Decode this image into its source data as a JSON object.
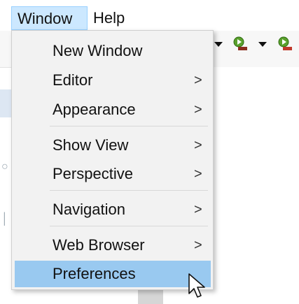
{
  "menubar": {
    "items": [
      {
        "label": "Window",
        "active": true
      },
      {
        "label": "Help",
        "active": false
      }
    ]
  },
  "menu": {
    "items": [
      {
        "label": "New Window",
        "submenu": false
      },
      {
        "label": "Editor",
        "submenu": true,
        "chevron": ">"
      },
      {
        "label": "Appearance",
        "submenu": true,
        "chevron": ">"
      },
      {
        "label": "Show View",
        "submenu": true,
        "chevron": ">"
      },
      {
        "label": "Perspective",
        "submenu": true,
        "chevron": ">"
      },
      {
        "label": "Navigation",
        "submenu": true,
        "chevron": ">"
      },
      {
        "label": "Web Browser",
        "submenu": true,
        "chevron": ">"
      },
      {
        "label": "Preferences",
        "submenu": false,
        "selected": true
      }
    ]
  },
  "colors": {
    "menu_bg": "#f2f2f2",
    "selected_bg": "#99c9f0",
    "menubar_active": "#cce8ff"
  },
  "icons": [
    "run-icon",
    "debug-icon",
    "dropdown-arrow-icon",
    "mouse-pointer-icon"
  ]
}
